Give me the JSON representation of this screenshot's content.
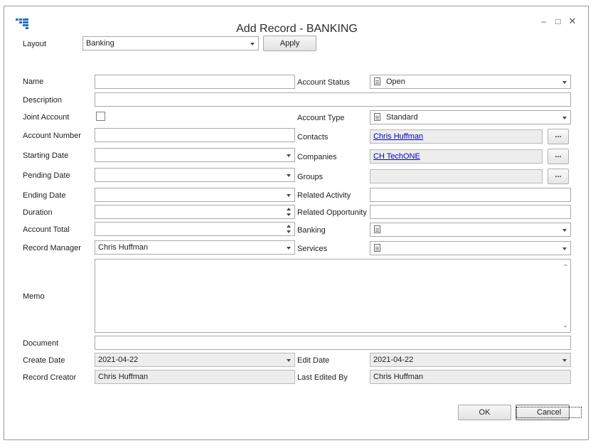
{
  "window": {
    "title": "Add Record - BANKING",
    "controls": {
      "minimize": "–",
      "maximize": "□",
      "close": "✕"
    },
    "icon": "grid-app-icon"
  },
  "layout": {
    "label": "Layout",
    "value": "Banking",
    "apply_label": "Apply"
  },
  "left": {
    "name": {
      "label": "Name",
      "value": ""
    },
    "description": {
      "label": "Description",
      "value": ""
    },
    "joint_account": {
      "label": "Joint Account",
      "checked": false
    },
    "account_number": {
      "label": "Account Number",
      "value": ""
    },
    "starting_date": {
      "label": "Starting Date",
      "value": ""
    },
    "pending_date": {
      "label": "Pending Date",
      "value": ""
    },
    "ending_date": {
      "label": "Ending Date",
      "value": ""
    },
    "duration": {
      "label": "Duration",
      "value": ""
    },
    "account_total": {
      "label": "Account Total",
      "value": ""
    },
    "record_manager": {
      "label": "Record Manager",
      "value": "Chris Huffman"
    },
    "memo": {
      "label": "Memo",
      "value": ""
    },
    "document": {
      "label": "Document",
      "value": ""
    },
    "create_date": {
      "label": "Create Date",
      "value": "2021-04-22"
    },
    "record_creator": {
      "label": "Record Creator",
      "value": "Chris Huffman"
    }
  },
  "right": {
    "account_status": {
      "label": "Account Status",
      "value": "Open"
    },
    "account_type": {
      "label": "Account Type",
      "value": "Standard"
    },
    "contacts": {
      "label": "Contacts",
      "value": "Chris Huffman",
      "button": "..."
    },
    "companies": {
      "label": "Companies",
      "value": "CH TechONE",
      "button": "..."
    },
    "groups": {
      "label": "Groups",
      "value": "",
      "button": "..."
    },
    "related_activity": {
      "label": "Related Activity",
      "value": ""
    },
    "related_opportunity": {
      "label": "Related Opportunity",
      "value": ""
    },
    "banking": {
      "label": "Banking",
      "value": ""
    },
    "services": {
      "label": "Services",
      "value": ""
    },
    "edit_date": {
      "label": "Edit Date",
      "value": "2021-04-22"
    },
    "last_edited_by": {
      "label": "Last Edited By",
      "value": "Chris Huffman"
    }
  },
  "footer": {
    "ok_label": "OK",
    "cancel_label": "Cancel"
  },
  "colors": {
    "link": "#0000cc",
    "readonly_bg": "#ededed",
    "app_icon": "#2f6db5"
  }
}
